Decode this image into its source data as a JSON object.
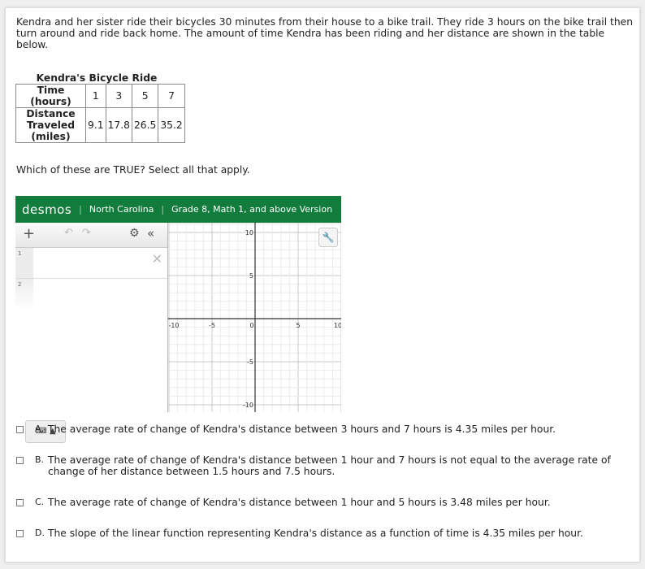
{
  "stem": "Kendra and her sister ride their bicycles 30 minutes from their house to a bike trail. They ride 3 hours on the bike trail then turn around and ride back home. The amount of time Kendra has been riding and her distance are shown in the table below.",
  "table": {
    "caption": "Kendra's Bicycle Ride",
    "row1_header": "Time (hours)",
    "row1": [
      "1",
      "3",
      "5",
      "7"
    ],
    "row2_header": "Distance Traveled (miles)",
    "row2": [
      "9.1",
      "17.8",
      "26.5",
      "35.2"
    ]
  },
  "prompt": "Which of these are TRUE? Select all that apply.",
  "desmos": {
    "logo": "desmos",
    "region": "North Carolina",
    "version": "Grade 8, Math 1, and above Version",
    "rows": [
      "1",
      "2"
    ],
    "brand_color": "#127c3c",
    "x_ticks": [
      "-10",
      "-5",
      "0",
      "5",
      "10"
    ],
    "y_ticks": [
      "10",
      "5",
      "-5",
      "-10"
    ]
  },
  "options": [
    {
      "letter": "A.",
      "text": "The average rate of change of Kendra's distance between 3 hours and 7 hours is 4.35 miles per hour."
    },
    {
      "letter": "B.",
      "text": "The average rate of change of Kendra's distance between 1 hour and 7 hours is not equal to the average rate of change of her distance between 1.5 hours and 7.5 hours."
    },
    {
      "letter": "C.",
      "text": "The average rate of change of Kendra's distance between 1 hour and 5 hours is 3.48 miles per hour."
    },
    {
      "letter": "D.",
      "text": "The slope of the linear function representing Kendra's distance as a function of time is 4.35 miles per hour."
    }
  ]
}
